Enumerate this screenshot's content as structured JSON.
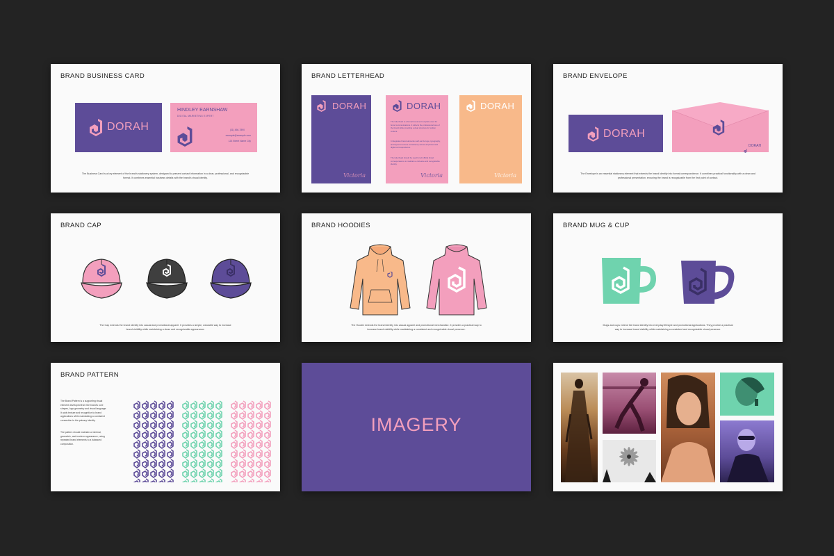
{
  "colors": {
    "purple": "#5d4c98",
    "pink": "#f39fbd",
    "peach": "#f8b98a",
    "mint": "#6fd3ae",
    "dark": "#3d3d3d",
    "background": "#232323"
  },
  "brand": {
    "name": "DORAH",
    "signature": "Victoria"
  },
  "slides": {
    "business_card": {
      "title": "BRAND BUSINESS CARD",
      "person_name": "HINDLEY EARNSHAW",
      "person_role": "DIGITAL MARKETING EXPERT",
      "phone": "(31) 456-7890",
      "email": "example@example.com",
      "address": "123 Street Name City",
      "description": "The Business Card is a key element of the brand's stationery system, designed to present contact information in a clear, professional, and recognizable format. It combines essential business details with the brand's visual identity."
    },
    "letterhead": {
      "title": "BRAND LETTERHEAD",
      "body_p1": "The letterhead is a formal document template used for brand communications. It reflects the professional tone of the brand while providing a clear structure for written content.",
      "body_p2": "It integrates brand elements such as the logo, typography, and layout to ensure consistency across all printed and digital correspondence.",
      "body_p3": "The letterhead should be used for all official brand correspondence to maintain a cohesive and recognizable identity."
    },
    "envelope": {
      "title": "BRAND ENVELOPE",
      "description": "The Envelope is an essential stationery element that extends the brand identity into formal correspondence. It combines practical functionality with a clean and professional presentation, ensuring the brand is recognizable from the first point of contact."
    },
    "cap": {
      "title": "BRAND CAP",
      "description": "The Cap extends the brand identity into casual and promotional apparel. It provides a simple, wearable way to increase brand visibility while maintaining a clean and recognizable appearance."
    },
    "hoodies": {
      "title": "BRAND HOODIES",
      "description": "The Hoodie extends the brand identity into casual apparel and promotional merchandise. It provides a practical way to increase brand visibility while maintaining a consistent and recognizable visual presence."
    },
    "mug": {
      "title": "BRAND MUG & CUP",
      "description": "Mugs and cups extend the brand identity into everyday lifestyle and promotional applications. They provide a practical way to increase brand visibility while maintaining a consistent and recognizable visual presence."
    },
    "pattern": {
      "title": "BRAND PATTERN",
      "description_p1": "The Brand Pattern is a supporting visual element developed from the brand's core shapes, logo geometry and visual language. It adds texture and recognition to brand applications while maintaining a consistent connection to the primary identity.",
      "description_p2": "The pattern should maintain a minimal, geometric, and modern appearance, using repeated brand elements to a balanced composition."
    },
    "imagery": {
      "title": "IMAGERY"
    }
  }
}
